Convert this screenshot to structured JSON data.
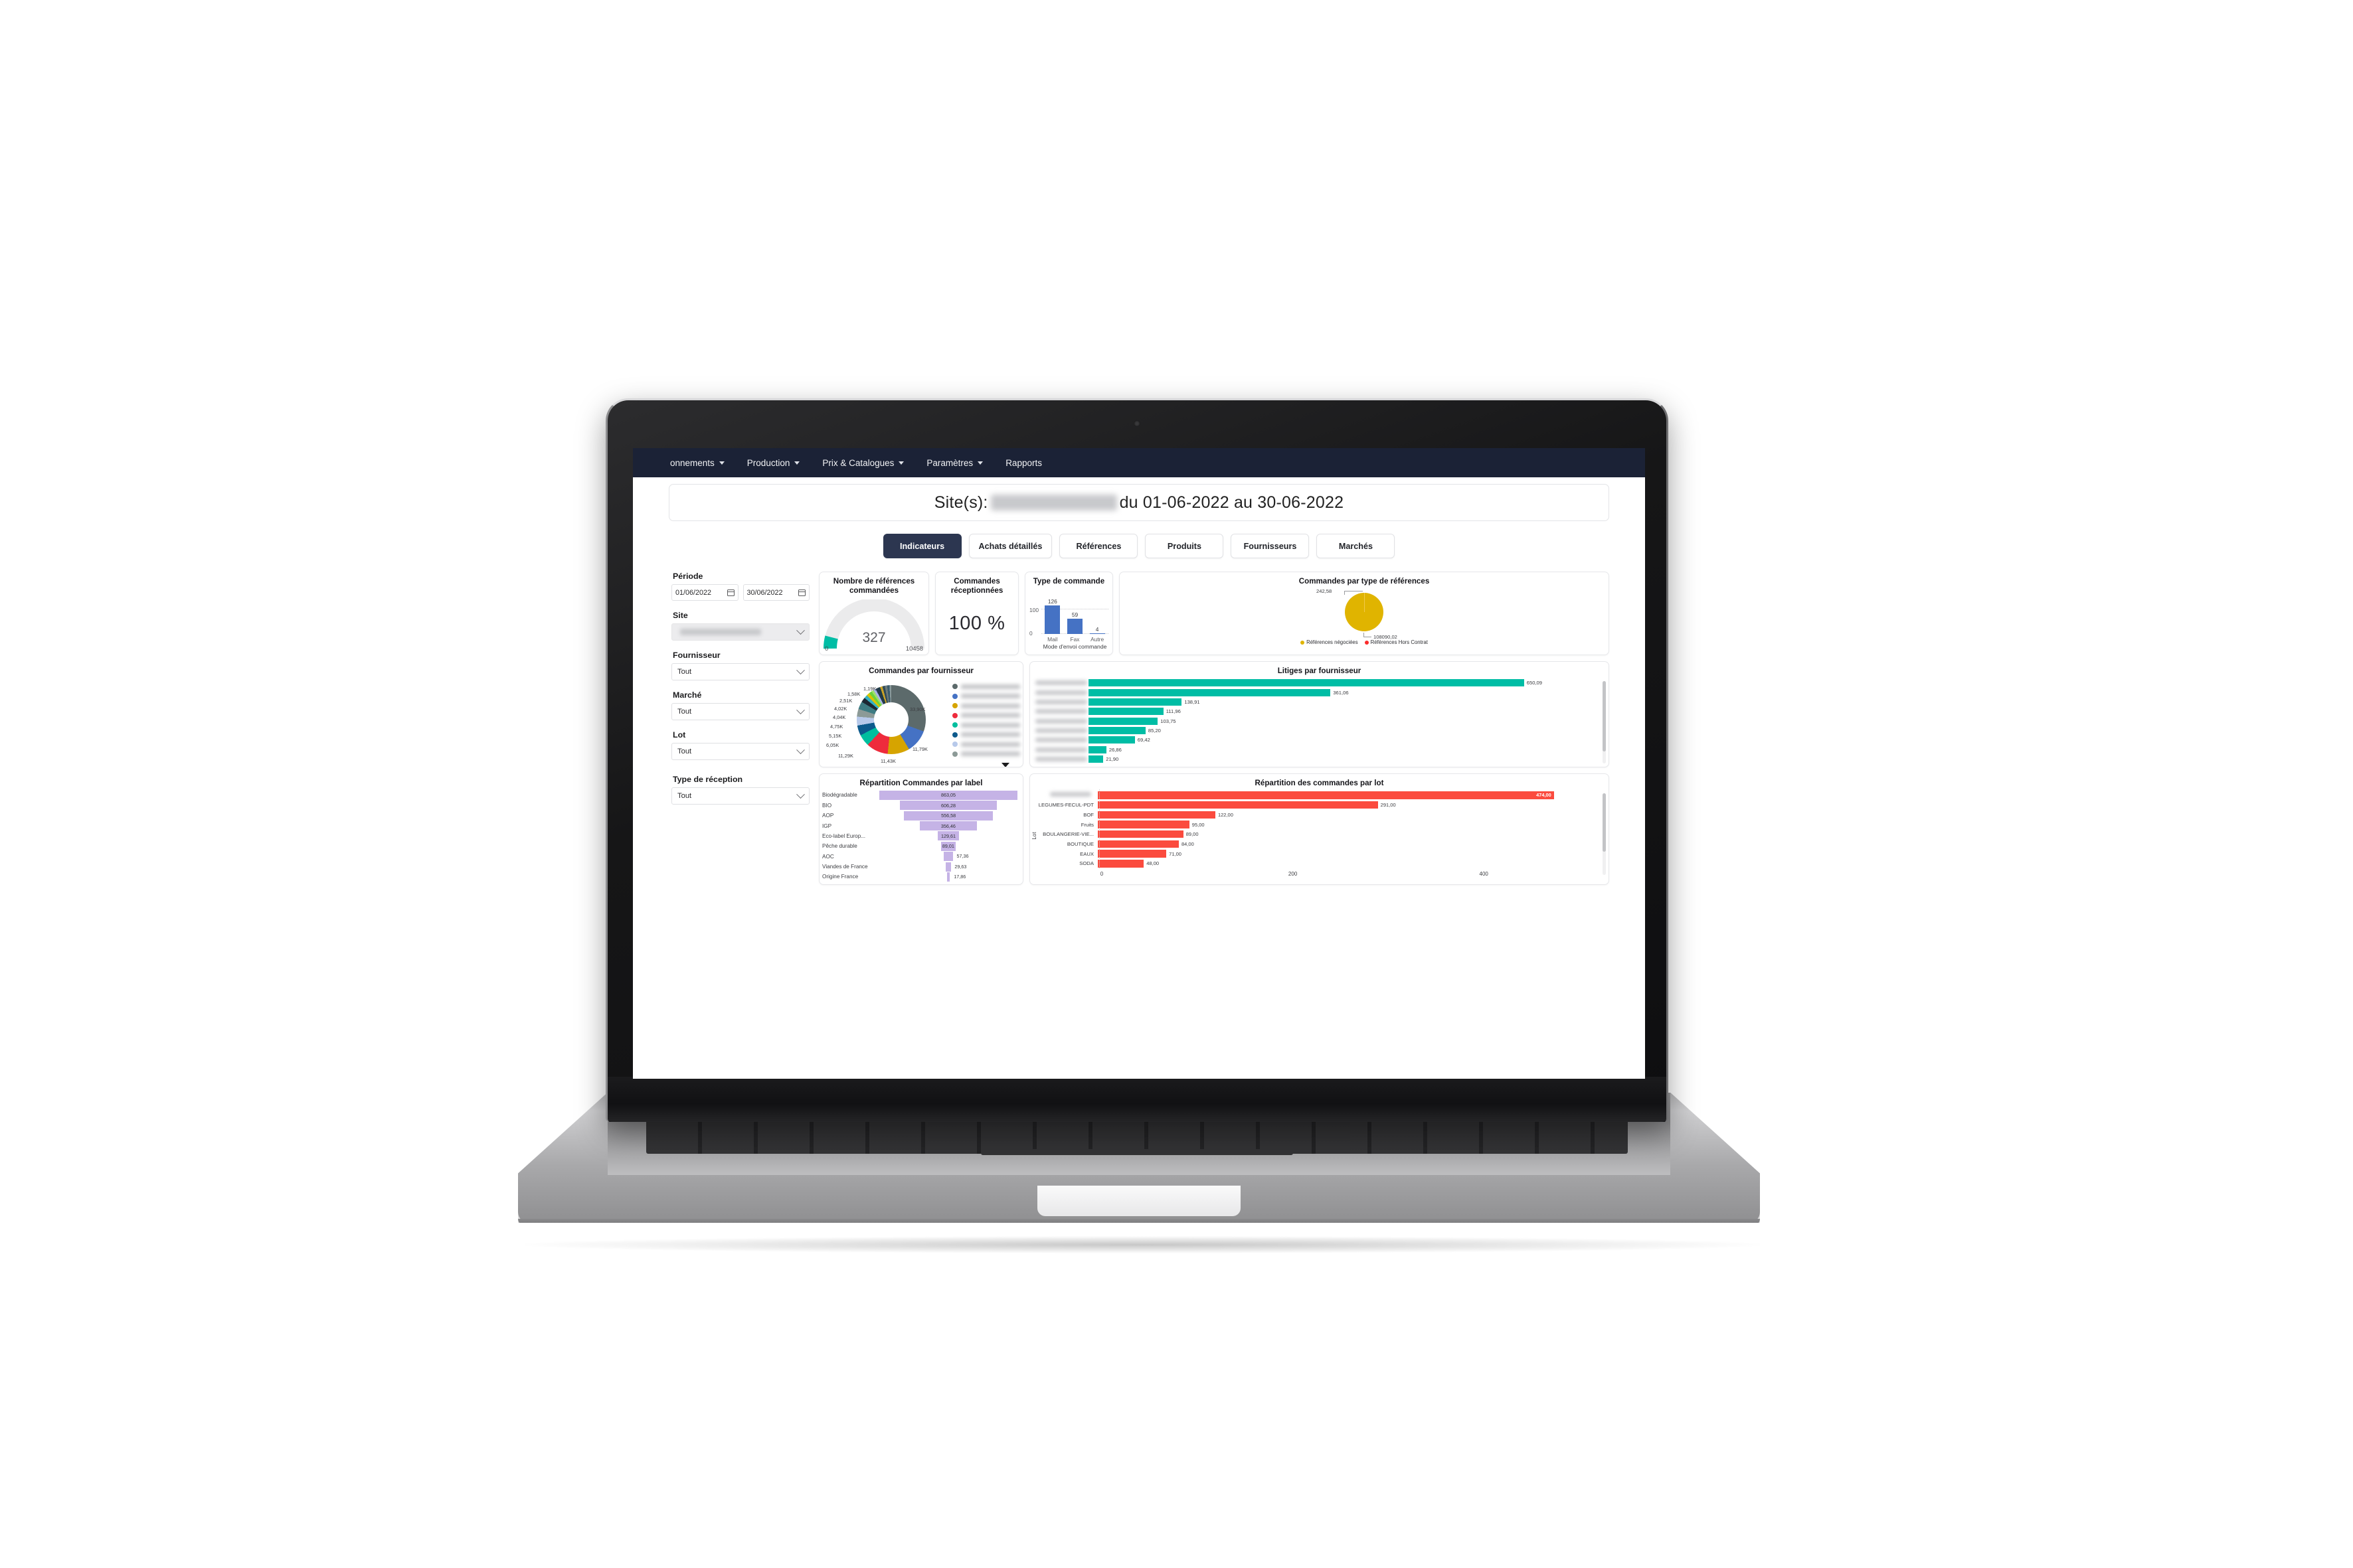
{
  "navbar": {
    "items": [
      {
        "label": "onnements",
        "has_caret": true
      },
      {
        "label": "Production",
        "has_caret": true
      },
      {
        "label": "Prix & Catalogues",
        "has_caret": true
      },
      {
        "label": "Paramètres",
        "has_caret": true
      },
      {
        "label": "Rapports",
        "has_caret": false
      }
    ]
  },
  "banner": {
    "prefix": "Site(s):",
    "site_redacted": "Angelina Chateau Versailles",
    "suffix": "du 01-06-2022 au 30-06-2022"
  },
  "tabs": [
    {
      "label": "Indicateurs",
      "active": true
    },
    {
      "label": "Achats détaillés",
      "active": false
    },
    {
      "label": "Références",
      "active": false
    },
    {
      "label": "Produits",
      "active": false
    },
    {
      "label": "Fournisseurs",
      "active": false
    },
    {
      "label": "Marchés",
      "active": false
    }
  ],
  "filters": {
    "periode": {
      "label": "Période",
      "start": "01/06/2022",
      "end": "30/06/2022"
    },
    "site": {
      "label": "Site",
      "value": "Angelina Chateau Versailles",
      "redacted": true
    },
    "fournisseur": {
      "label": "Fournisseur",
      "value": "Tout"
    },
    "marche": {
      "label": "Marché",
      "value": "Tout"
    },
    "lot": {
      "label": "Lot",
      "value": "Tout"
    },
    "type_reception": {
      "label": "Type de réception",
      "value": "Tout"
    }
  },
  "cards": {
    "gauge": {
      "title": "Nombre de références commandées"
    },
    "reception": {
      "title": "Commandes réceptionnées",
      "value": "100 %"
    },
    "type_commande": {
      "title": "Type de commande"
    },
    "pie": {
      "title": "Commandes par type de références"
    },
    "donut": {
      "title": "Commandes par fournisseur"
    },
    "litiges": {
      "title": "Litiges par fournisseur"
    },
    "label": {
      "title": "Répartition Commandes par label"
    },
    "lot": {
      "title": "Répartition des commandes par lot"
    }
  },
  "chart_data": [
    {
      "type": "gauge",
      "title": "Nombre de références commandées",
      "value": 327,
      "value_label": "327",
      "min": 0,
      "max": 10458,
      "min_label": "0",
      "max_label": "10458",
      "color": "#00BDA5",
      "track_color": "#EBEBEC"
    },
    {
      "type": "kpi",
      "title": "Commandes réceptionnées",
      "value_label": "100 %",
      "value": 100
    },
    {
      "type": "bar",
      "title": "Type de commande",
      "categories": [
        "Mail",
        "Fax",
        "Autre"
      ],
      "values": [
        126,
        59,
        4
      ],
      "value_labels": [
        "126",
        "59",
        "4"
      ],
      "xlabel": "Mode d'envoi commande",
      "ylabel": "",
      "ytick_labels": [
        "0",
        "100"
      ],
      "ylim": [
        0,
        140
      ],
      "grid": true,
      "color": "#4572C4"
    },
    {
      "type": "pie",
      "title": "Commandes par type de références",
      "categories": [
        "Références négociées",
        "Références Hors Contrat"
      ],
      "values": [
        108090.02,
        242.58
      ],
      "value_labels": [
        "108090,02",
        "242,58"
      ],
      "colors": [
        "#E0B400",
        "#FB2B2B"
      ],
      "legend": [
        "Références négociées",
        "Références Hors Contrat"
      ],
      "legend_position": "bottom"
    },
    {
      "type": "pie",
      "title": "Commandes par fournisseur",
      "subtype": "donut",
      "value_labels": [
        "33,90K",
        "11,79K",
        "11,43K",
        "11,29K",
        "6,05K",
        "5,15K",
        "4,75K",
        "4,04K",
        "4,02K",
        "2,51K",
        "1,58K",
        "1,19K"
      ],
      "values": [
        33900,
        11790,
        11430,
        11290,
        6050,
        5150,
        4750,
        4040,
        4020,
        2510,
        1580,
        1190
      ],
      "colors": [
        "#5C6A6B",
        "#4572C4",
        "#D6A400",
        "#EE2B3C",
        "#00BE9E",
        "#0D5A8C",
        "#B7C9EA",
        "#8C9A97",
        "#3D7B82",
        "#1C2833",
        "#36B0C2",
        "#D9C400"
      ],
      "extra_colors": [
        "#6BD43B",
        "#9FE06B",
        "#A8B4E8",
        "#253A4C",
        "#1F3B46",
        "#C9A227"
      ],
      "legend_redacted": true,
      "legend_entries": 8
    },
    {
      "type": "bar",
      "subtype": "horizontal",
      "title": "Litiges par fournisseur",
      "categories_redacted": true,
      "categories": [
        "",
        "",
        "",
        "",
        "",
        "",
        "",
        "",
        ""
      ],
      "values": [
        650.09,
        361.06,
        138.91,
        111.96,
        103.75,
        85.2,
        69.42,
        26.86,
        21.9
      ],
      "value_labels": [
        "650,09",
        "361,06",
        "138,91",
        "111,96",
        "103,75",
        "85,20",
        "69,42",
        "26,86",
        "21,90"
      ],
      "color": "#00BDA5",
      "xlim": [
        0,
        700
      ]
    },
    {
      "type": "bar",
      "subtype": "funnel",
      "title": "Répartition Commandes par label",
      "categories": [
        "Biodégradable",
        "BIO",
        "AOP",
        "IGP",
        "Eco-label Europ...",
        "Pêche durable",
        "AOC",
        "Viandes de France",
        "Origine France"
      ],
      "values": [
        863.05,
        606.28,
        556.58,
        356.46,
        129.61,
        89.01,
        57.36,
        29.63,
        17.86
      ],
      "value_labels": [
        "863,05",
        "606,28",
        "556,58",
        "356,46",
        "129,61",
        "89,01",
        "57,36",
        "29,63",
        "17,86"
      ],
      "color": "#C5B3E6",
      "xlim": [
        0,
        863.05
      ]
    },
    {
      "type": "bar",
      "subtype": "horizontal",
      "title": "Répartition des commandes par lot",
      "ylabel": "Lot",
      "categories": [
        "",
        "LEGUMES-FECUL-PDT",
        "BOF",
        "Fruits",
        "BOULANGERIE-VIE...",
        "BOUTIQUE",
        "EAUX",
        "SODA"
      ],
      "first_category_redacted": true,
      "values": [
        474.0,
        291.0,
        122.0,
        95.0,
        89.0,
        84.0,
        71.0,
        48.0
      ],
      "value_labels": [
        "474,00",
        "291,00",
        "122,00",
        "95,00",
        "89,00",
        "84,00",
        "71,00",
        "48,00"
      ],
      "color": "#FB4B3E",
      "xtick_labels": [
        "0",
        "200",
        "400"
      ],
      "xticks": [
        0,
        200,
        400
      ],
      "xlim": [
        0,
        520
      ],
      "grid": true
    }
  ],
  "theme": {
    "navbar_bg": "#1B2236",
    "tab_active_bg": "#2C3650",
    "teal": "#00BDA5",
    "blue": "#4572C4",
    "purple": "#C5B3E6",
    "red": "#FB4B3E",
    "gold": "#E0B400"
  }
}
